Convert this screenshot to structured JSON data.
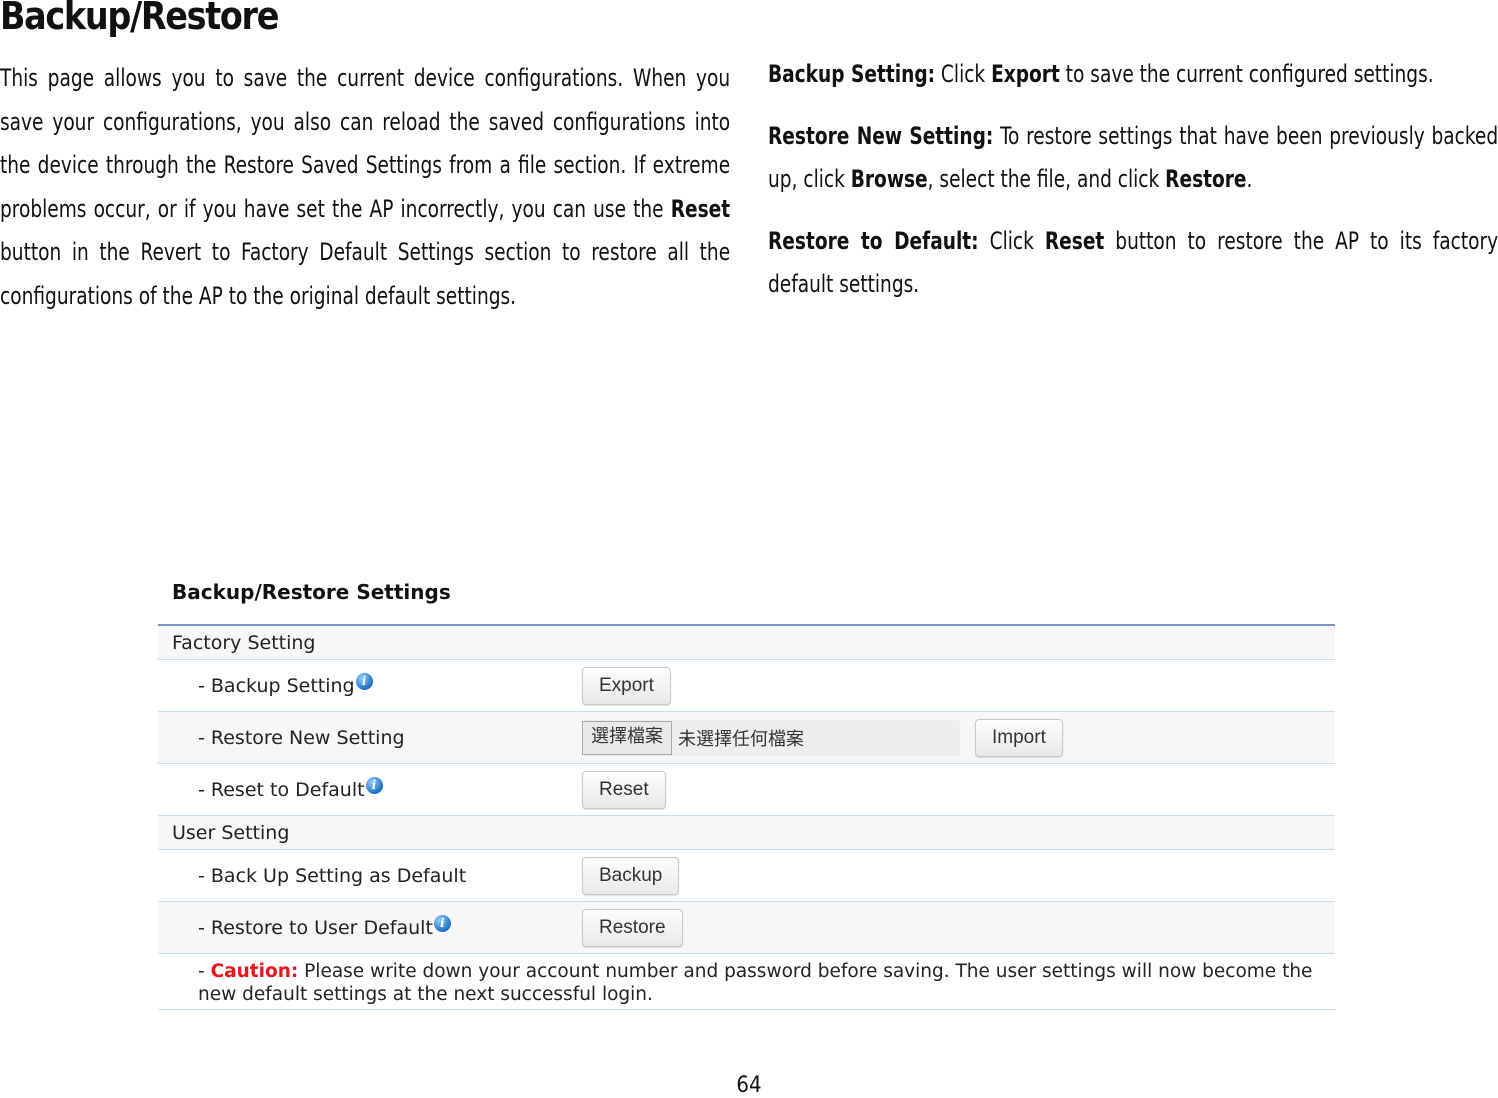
{
  "page": {
    "title": "Backup/Restore",
    "intro": {
      "part1": "This page allows you to save the current device configurations. When you save your configurations, you also can reload the saved configurations into the device through the Restore Saved Settings from a file section. If extreme problems occur, or if you have set the AP incorrectly, you can use the ",
      "bold1": "Reset",
      "part2": " button in the Revert to Factory Default Settings section to restore all the configurations of the AP to the original default settings."
    },
    "descriptions": [
      {
        "term": "Backup Setting:",
        "t1": " Click ",
        "b1": "Export",
        "t2": " to save the current configured settings.",
        "b2": "",
        "t3": ""
      },
      {
        "term": "Restore New Setting:",
        "t1": " To restore settings that have been previously backed up, click ",
        "b1": "Browse",
        "t2": ", select the file, and click ",
        "b2": "Restore",
        "t3": "."
      },
      {
        "term": "Restore to Default:",
        "t1": " Click ",
        "b1": "Reset",
        "t2": " button to restore the AP to its factory default settings.",
        "b2": "",
        "t3": ""
      }
    ],
    "page_number": "64"
  },
  "screenshot": {
    "title": "Backup/Restore Settings",
    "sections": {
      "factory": "Factory Setting",
      "user": "User Setting"
    },
    "rows": {
      "backup_setting": {
        "label": "- Backup Setting",
        "button": "Export"
      },
      "restore_new": {
        "label": "- Restore New Setting",
        "file_button": "選擇檔案",
        "file_status": "未選擇任何檔案",
        "button": "Import"
      },
      "reset_default": {
        "label": "- Reset to Default",
        "button": "Reset"
      },
      "backup_as_default": {
        "label": "- Back Up Setting as Default",
        "button": "Backup"
      },
      "restore_user_default": {
        "label": "- Restore to User Default",
        "button": "Restore"
      }
    },
    "info_icon": "i",
    "caution": {
      "prefix": "- ",
      "label": "Caution:",
      "text": " Please write down your account number and password before saving. The user settings will now become the new default settings at the next successful login."
    },
    "colors": {
      "caution": "#e8151b",
      "table_top_border": "#7f95c2",
      "row_border": "#c9dce9",
      "info_icon": "#1e6fc4"
    }
  }
}
